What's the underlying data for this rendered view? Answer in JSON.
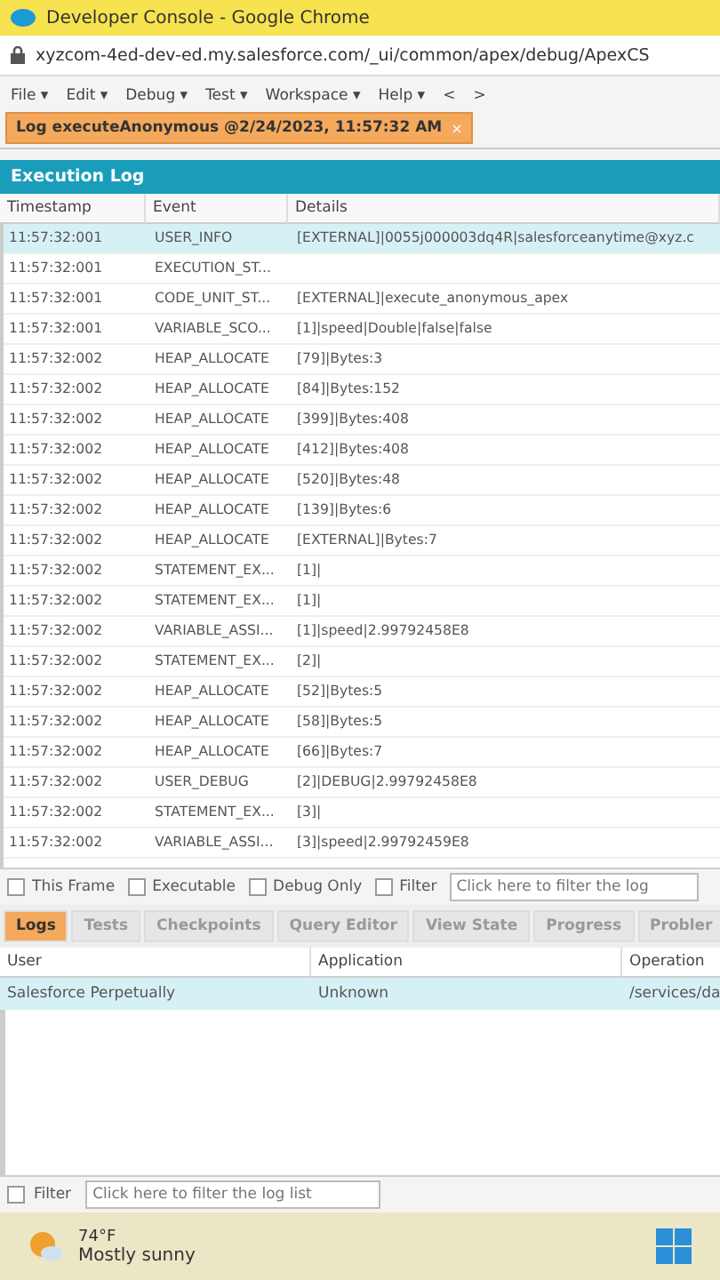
{
  "window": {
    "title": "Developer Console - Google Chrome"
  },
  "address_bar": {
    "url": "xyzcom-4ed-dev-ed.my.salesforce.com/_ui/common/apex/debug/ApexCS"
  },
  "menu": [
    "File ▾",
    "Edit ▾",
    "Debug ▾",
    "Test ▾",
    "Workspace ▾",
    "Help ▾",
    "<",
    ">"
  ],
  "editor_tabs": [
    {
      "label": "Log executeAnonymous @2/24/2023, 11:57:32 AM",
      "close": "×",
      "selected": true
    }
  ],
  "execution_log": {
    "title": "Execution Log",
    "columns": [
      "Timestamp",
      "Event",
      "Details"
    ],
    "rows": [
      {
        "timestamp": "11:57:32:001",
        "event": "USER_INFO",
        "details": "[EXTERNAL]|0055j000003dq4R|salesforceanytime@xyz.c",
        "selected": true
      },
      {
        "timestamp": "11:57:32:001",
        "event": "EXECUTION_ST...",
        "details": "",
        "selected": false
      },
      {
        "timestamp": "11:57:32:001",
        "event": "CODE_UNIT_ST...",
        "details": "[EXTERNAL]|execute_anonymous_apex",
        "selected": false
      },
      {
        "timestamp": "11:57:32:001",
        "event": "VARIABLE_SCO...",
        "details": "[1]|speed|Double|false|false",
        "selected": false
      },
      {
        "timestamp": "11:57:32:002",
        "event": "HEAP_ALLOCATE",
        "details": "[79]|Bytes:3",
        "selected": false
      },
      {
        "timestamp": "11:57:32:002",
        "event": "HEAP_ALLOCATE",
        "details": "[84]|Bytes:152",
        "selected": false
      },
      {
        "timestamp": "11:57:32:002",
        "event": "HEAP_ALLOCATE",
        "details": "[399]|Bytes:408",
        "selected": false
      },
      {
        "timestamp": "11:57:32:002",
        "event": "HEAP_ALLOCATE",
        "details": "[412]|Bytes:408",
        "selected": false
      },
      {
        "timestamp": "11:57:32:002",
        "event": "HEAP_ALLOCATE",
        "details": "[520]|Bytes:48",
        "selected": false
      },
      {
        "timestamp": "11:57:32:002",
        "event": "HEAP_ALLOCATE",
        "details": "[139]|Bytes:6",
        "selected": false
      },
      {
        "timestamp": "11:57:32:002",
        "event": "HEAP_ALLOCATE",
        "details": "[EXTERNAL]|Bytes:7",
        "selected": false
      },
      {
        "timestamp": "11:57:32:002",
        "event": "STATEMENT_EX...",
        "details": "[1]|",
        "selected": false
      },
      {
        "timestamp": "11:57:32:002",
        "event": "STATEMENT_EX...",
        "details": "[1]|",
        "selected": false
      },
      {
        "timestamp": "11:57:32:002",
        "event": "VARIABLE_ASSI...",
        "details": "[1]|speed|2.99792458E8",
        "selected": false
      },
      {
        "timestamp": "11:57:32:002",
        "event": "STATEMENT_EX...",
        "details": "[2]|",
        "selected": false
      },
      {
        "timestamp": "11:57:32:002",
        "event": "HEAP_ALLOCATE",
        "details": "[52]|Bytes:5",
        "selected": false
      },
      {
        "timestamp": "11:57:32:002",
        "event": "HEAP_ALLOCATE",
        "details": "[58]|Bytes:5",
        "selected": false
      },
      {
        "timestamp": "11:57:32:002",
        "event": "HEAP_ALLOCATE",
        "details": "[66]|Bytes:7",
        "selected": false
      },
      {
        "timestamp": "11:57:32:002",
        "event": "USER_DEBUG",
        "details": "[2]|DEBUG|2.99792458E8",
        "selected": false
      },
      {
        "timestamp": "11:57:32:002",
        "event": "STATEMENT_EX...",
        "details": "[3]|",
        "selected": false
      },
      {
        "timestamp": "11:57:32:002",
        "event": "VARIABLE_ASSI...",
        "details": "[3]|speed|2.99792459E8",
        "selected": false
      }
    ],
    "filters": [
      {
        "label": "This Frame",
        "checked": false
      },
      {
        "label": "Executable",
        "checked": false
      },
      {
        "label": "Debug Only",
        "checked": false
      },
      {
        "label": "Filter",
        "checked": false
      }
    ],
    "filter_field": {
      "placeholder": "Click here to filter the log"
    }
  },
  "panel_tabs": [
    {
      "label": "Logs",
      "selected": true
    },
    {
      "label": "Tests",
      "selected": false
    },
    {
      "label": "Checkpoints",
      "selected": false
    },
    {
      "label": "Query Editor",
      "selected": false
    },
    {
      "label": "View State",
      "selected": false
    },
    {
      "label": "Progress",
      "selected": false
    },
    {
      "label": "Probler",
      "selected": false
    }
  ],
  "logs_table": {
    "columns": [
      "User",
      "Application",
      "Operation"
    ],
    "rows": [
      {
        "user": "Salesforce Perpetually",
        "application": "Unknown",
        "operation": "/services/da",
        "selected": true
      }
    ]
  },
  "log_filter": {
    "label": "Filter",
    "checked": false,
    "placeholder": "Click here to filter the log list"
  },
  "taskbar": {
    "temperature": "74°F",
    "condition": "Mostly sunny"
  }
}
